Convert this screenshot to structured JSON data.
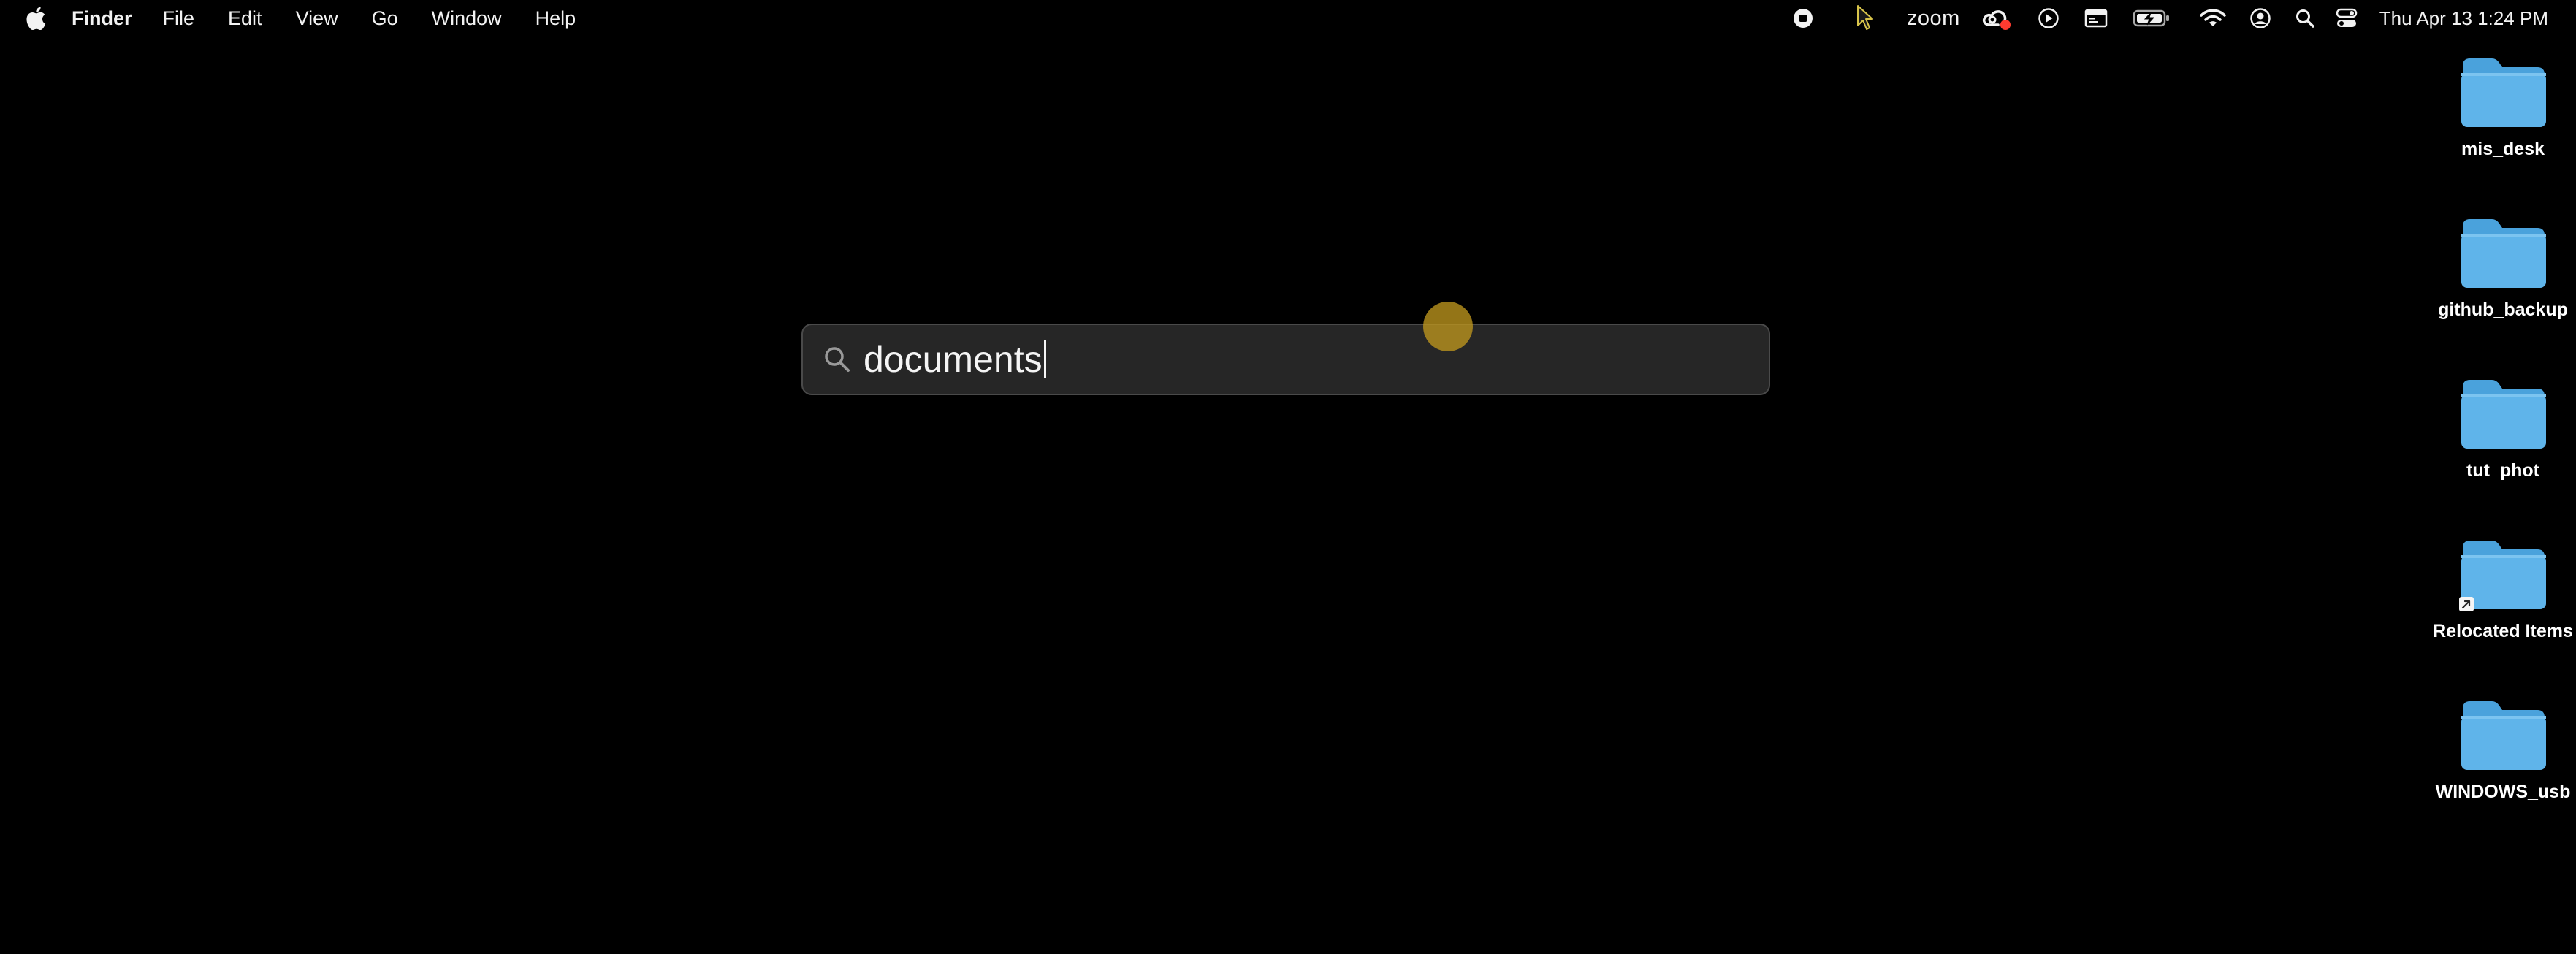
{
  "menubar": {
    "apple_icon": "apple-logo-icon",
    "app_name": "Finder",
    "menus": [
      "File",
      "Edit",
      "View",
      "Go",
      "Window",
      "Help"
    ],
    "status": {
      "zoom_label": "zoom",
      "clock": "Thu Apr 13  1:24 PM",
      "icons": [
        "record-stop-icon",
        "cursor-icon",
        "creative-cloud-icon",
        "play-icon",
        "display-icon",
        "battery-charging-icon",
        "wifi-icon",
        "user-account-icon",
        "spotlight-search-icon",
        "control-center-icon"
      ]
    }
  },
  "search": {
    "query": "documents",
    "icon": "magnifier-icon"
  },
  "desktop": {
    "items": [
      {
        "label": "mis_desk",
        "icon": "folder-icon"
      },
      {
        "label": "github_backup",
        "icon": "folder-icon"
      },
      {
        "label": "tut_phot",
        "icon": "folder-icon"
      },
      {
        "label": "Relocated Items",
        "icon": "folder-alias-icon"
      },
      {
        "label": "WINDOWS_usb",
        "icon": "folder-icon"
      }
    ]
  },
  "colors": {
    "background": "#000000",
    "folder": "#5fb4ea",
    "folder_tab": "#4aa2dc",
    "search_bg": "#262626",
    "click_highlight": "#be961e"
  }
}
